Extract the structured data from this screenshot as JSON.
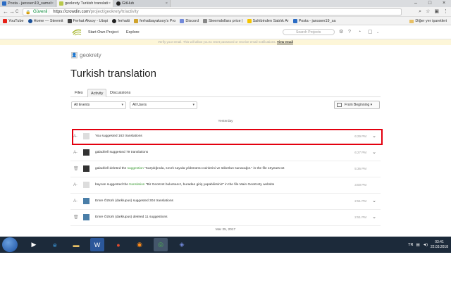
{
  "browser": {
    "tabs": [
      {
        "label": "Posta - janssen19_samel",
        "color": "#2b6cc4"
      },
      {
        "label": "geokrety Turkish translati",
        "color": "#b8c84a"
      },
      {
        "label": "GitHub",
        "color": "#222222"
      }
    ],
    "nav": {
      "back": "←",
      "forward": "→",
      "reload": "C"
    },
    "omnibox": {
      "secure_label": "Güvenli",
      "url_host": "https://crowdin.com",
      "url_path": "/project/geokrety/tr/activity"
    },
    "actions": [
      "search-icon",
      "star-icon",
      "extension-icon",
      "menu-icon"
    ],
    "bookmarks": [
      {
        "label": "YouTube",
        "icon": "youtube-icon",
        "color": "#e62117"
      },
      {
        "label": "Home — Steemit",
        "icon": "steemit-icon",
        "color": "#1a5099"
      },
      {
        "label": "Ferhat Aksoy - Utopi",
        "icon": "utopian-icon",
        "color": "#444444"
      },
      {
        "label": "ferhatti",
        "icon": "github-icon",
        "color": "#222222"
      },
      {
        "label": "ferhatbayaksoy's Pro",
        "icon": "profile-icon",
        "color": "#cfa22b"
      },
      {
        "label": "Discord",
        "icon": "discord-icon",
        "color": "#7289da"
      },
      {
        "label": "Steemdollars price |",
        "icon": "coinmarket-icon",
        "color": "#888888"
      },
      {
        "label": "Sahibinden Satılık Ar",
        "icon": "sahibinden-icon",
        "color": "#f5c400"
      },
      {
        "label": "Posta - janssen19_sa",
        "icon": "outlook-icon",
        "color": "#2b6cc4"
      }
    ],
    "other_bookmarks": "Diğer yer işaretleri"
  },
  "crowdin": {
    "nav": [
      "Start Own Project",
      "Explore"
    ],
    "search_placeholder": "Search Projects",
    "notice_text": "Verify your email. This will allow you to reset password or receive email notifications.",
    "notice_link": "View email"
  },
  "page": {
    "username": "geokrety",
    "title": "Turkish translation",
    "tabs": [
      "Files",
      "Activity",
      "Discussions"
    ],
    "active_tab": "Activity",
    "filters": {
      "events": "All Events",
      "users": "All Users"
    },
    "from_button": "From Beginning ▾",
    "day_label_1": "Yesterday",
    "day_label_2": "Mar 25, 2017",
    "activity": [
      {
        "icon": "translate-icon",
        "avatar": "light",
        "text": "You suggested 163 translations",
        "link": "",
        "text2": "",
        "time": "6:29 PM",
        "chevron": true
      },
      {
        "icon": "translate-icon",
        "avatar": "dark",
        "text": "galadriell suggested 79 translations",
        "link": "",
        "text2": "",
        "time": "6:27 PM",
        "chevron": true
      },
      {
        "icon": "delete-icon",
        "avatar": "dark",
        "text": "galadriell deleted the ",
        "link": "suggestion",
        "text2": " \"Karşılığında, sınırlı sayıda yıldönümü coinlerini ve stikerları sunacağız.\" in the file 10years.txt",
        "time": "5:36 PM",
        "chevron": false
      },
      {
        "icon": "translate-icon",
        "avatar": "light",
        "text": "baycan suggested the ",
        "link": "translation",
        "text2": " \"Bir GeoKret bulursanız, buradan giriş yapabilirsiniz\" in the file Main GeoKrety website",
        "time": "3:00 PM",
        "chevron": false
      },
      {
        "icon": "translate-icon",
        "avatar": "img",
        "text": "Emre Öztürk (darklupus) suggested 304 translations",
        "link": "",
        "text2": "",
        "time": "2:51 PM",
        "chevron": true
      },
      {
        "icon": "delete-icon",
        "avatar": "img",
        "text": "Emre Öztürk (darklupus) deleted 11 suggestions",
        "link": "",
        "text2": "",
        "time": "2:51 PM",
        "chevron": true
      }
    ]
  },
  "taskbar": {
    "apps": [
      "folder-icon",
      "media-player-icon",
      "ie-icon",
      "explorer-icon",
      "word-icon",
      "app-icon",
      "firefox-icon",
      "chrome-icon",
      "discord-icon"
    ],
    "lang": "TR",
    "time": "03:41",
    "date": "22.03.2018"
  }
}
